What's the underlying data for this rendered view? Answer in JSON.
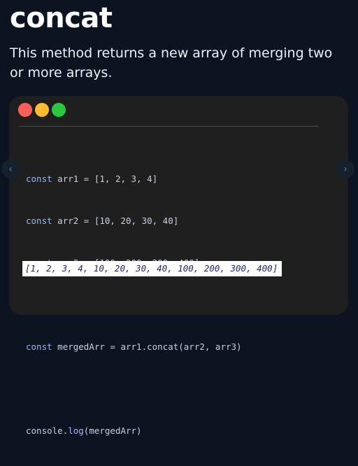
{
  "header": {
    "title": "concat",
    "subtitle": "This method returns a new array of merging two or more arrays."
  },
  "window": {
    "controls": [
      {
        "name": "close",
        "color": "#ff5f57"
      },
      {
        "name": "minimize",
        "color": "#febc2e"
      },
      {
        "name": "zoom",
        "color": "#28c840"
      }
    ]
  },
  "code": {
    "line1": {
      "kw": "const",
      "rest": " arr1 = [1, 2, 3, 4]"
    },
    "line2": {
      "kw": "const",
      "rest": " arr2 = [10, 20, 30, 40]"
    },
    "line3": {
      "kw": "const",
      "rest": " arr3 = [100, 200, 300, 400]"
    },
    "line4": {
      "kw": "const",
      "rest": " mergedArr = arr1.concat(arr2, arr3)"
    },
    "line5": {
      "obj": "console.",
      "fn": "log",
      "rest": "(mergedArr)"
    }
  },
  "output": {
    "text": "[1, 2, 3, 4, 10, 20, 30, 40, 100, 200, 300, 400]"
  },
  "nav": {
    "prev_icon": "‹",
    "next_icon": "›"
  }
}
